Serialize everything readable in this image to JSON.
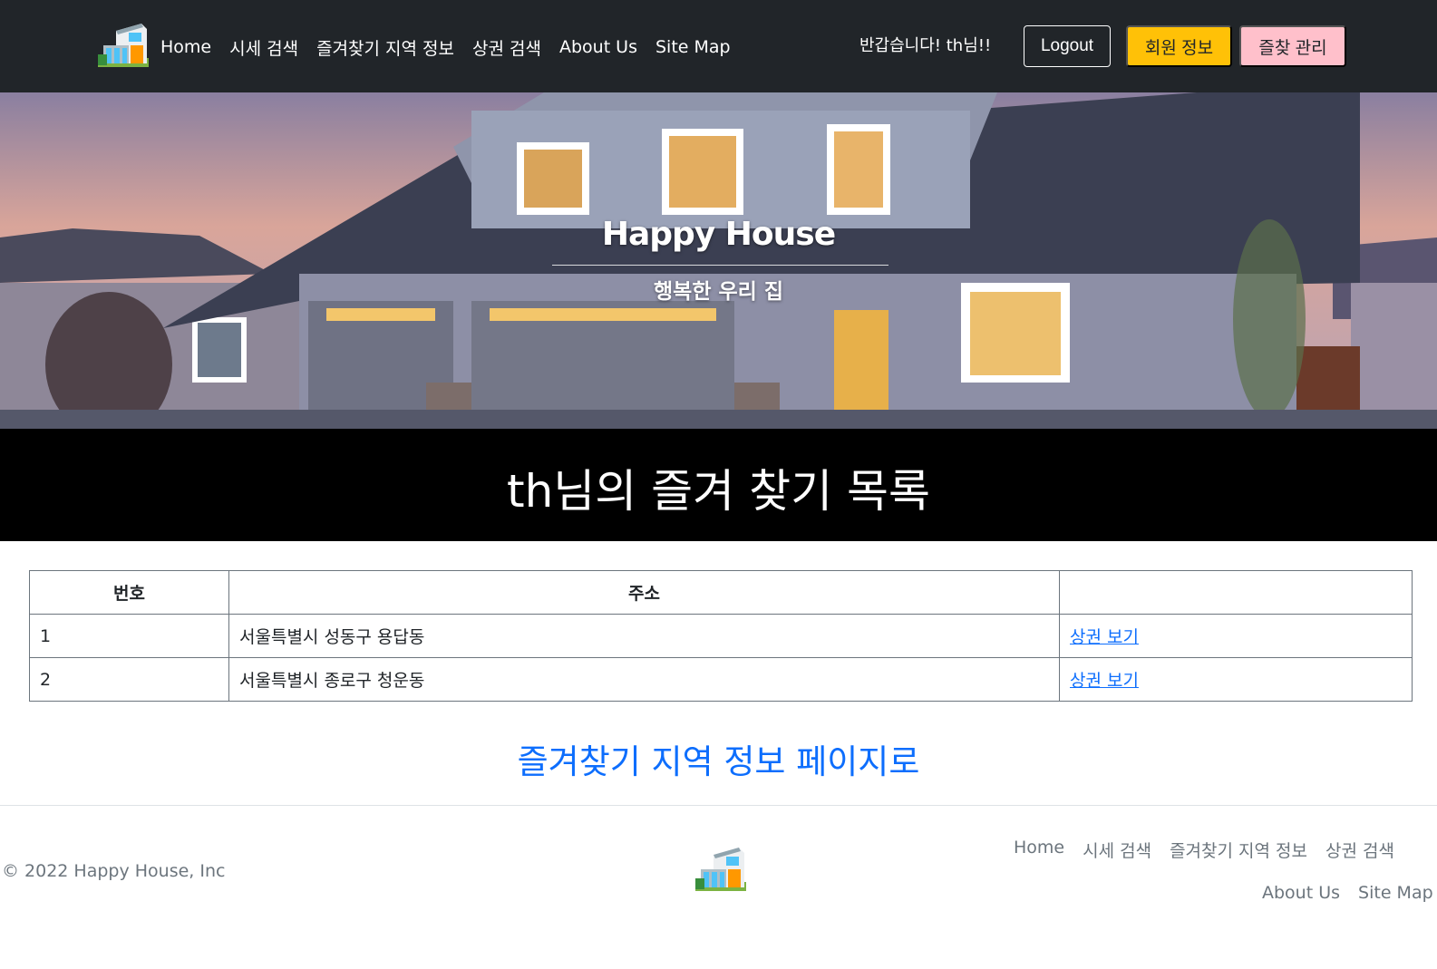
{
  "navbar": {
    "links": [
      "Home",
      "시세 검색",
      "즐겨찾기 지역 정보",
      "상권 검색",
      "About Us",
      "Site Map"
    ],
    "greeting": "반갑습니다! th님!!",
    "logout_label": "Logout",
    "member_info_label": "회원 정보",
    "fav_manage_label": "즐찾 관리",
    "colors": {
      "background": "#212529",
      "member_button": "#ffc107",
      "fav_button": "#ffc0cb"
    }
  },
  "hero": {
    "title": "Happy House",
    "subtitle": "행복한 우리 집"
  },
  "page": {
    "title": "th님의 즐겨 찾기 목록"
  },
  "table": {
    "headers": [
      "번호",
      "주소",
      ""
    ],
    "rows": [
      {
        "no": "1",
        "address": "서울특별시 성동구 용답동",
        "action": "상권 보기"
      },
      {
        "no": "2",
        "address": "서울특별시 종로구 청운동",
        "action": "상권 보기"
      }
    ]
  },
  "back_link": "즐겨찾기 지역 정보 페이지로",
  "footer": {
    "copyright": "© 2022 Happy House, Inc",
    "links": [
      "Home",
      "시세 검색",
      "즐겨찾기 지역 정보",
      "상권 검색",
      "About Us",
      "Site Map"
    ]
  }
}
